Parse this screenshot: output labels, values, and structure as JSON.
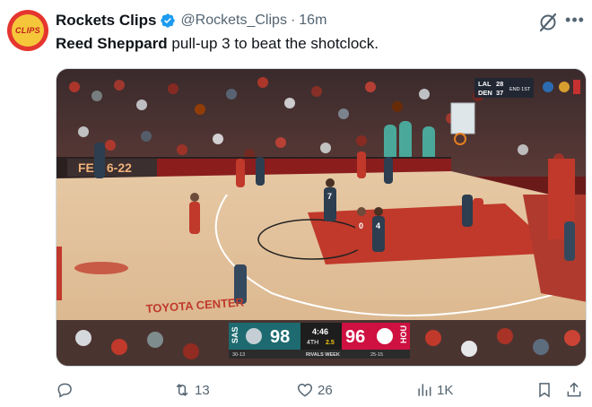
{
  "author": {
    "avatar_text": "CLIPS",
    "display_name": "Rockets Clips",
    "handle": "@Rockets_Clips",
    "separator": "·",
    "time": "16m"
  },
  "tweet": {
    "text_bold": "Reed Sheppard",
    "text_rest": " pull-up 3 to beat the shotclock."
  },
  "media": {
    "top_score": {
      "team1": "LAL",
      "score1": "28",
      "team2": "DEN",
      "score2": "37",
      "period": "END 1ST"
    },
    "scorebug": {
      "away_abbr": "SAS",
      "away_score": "98",
      "away_record": "30-13",
      "clock": "4:46",
      "quarter": "4TH",
      "shot_clock": "2.5",
      "home_score": "96",
      "home_abbr": "HOU",
      "home_record": "25-15",
      "banner": "RIVALS WEEK"
    },
    "arena_sign": "FEB 6-22",
    "court_sponsor": "TOYOTA CENTER",
    "jersey_numbers": [
      "7",
      "0",
      "4"
    ]
  },
  "actions": {
    "reply_count": "",
    "retweet_count": "13",
    "like_count": "26",
    "views_count": "1K"
  },
  "colors": {
    "verified": "#1d9bf0",
    "text_primary": "#0f1419",
    "text_secondary": "#536471",
    "rockets_red": "#ce1141",
    "spurs_teal": "#1d6b70"
  }
}
